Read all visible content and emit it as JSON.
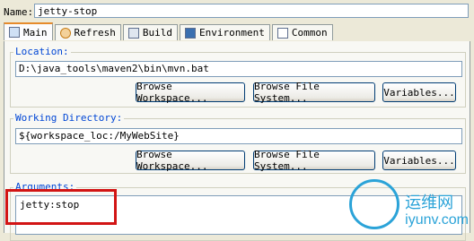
{
  "name": {
    "label": "Name:",
    "value": "jetty-stop"
  },
  "tabs": [
    {
      "label": "Main",
      "icon": "main-icon",
      "active": true
    },
    {
      "label": "Refresh",
      "icon": "refresh-icon"
    },
    {
      "label": "Build",
      "icon": "build-icon"
    },
    {
      "label": "Environment",
      "icon": "environment-icon"
    },
    {
      "label": "Common",
      "icon": "common-icon"
    }
  ],
  "location": {
    "title": "Location:",
    "value": "D:\\java_tools\\maven2\\bin\\mvn.bat",
    "buttons": [
      "Browse Workspace...",
      "Browse File System...",
      "Variables..."
    ]
  },
  "working_directory": {
    "title": "Working Directory:",
    "value": "${workspace_loc:/MyWebSite}",
    "buttons": [
      "Browse Workspace...",
      "Browse File System...",
      "Variables..."
    ]
  },
  "arguments": {
    "title": "Arguments:",
    "value": "jetty:stop"
  },
  "watermark": {
    "cn": "运维网",
    "url": "iyunv.com"
  },
  "colors": {
    "highlight": "#d21414",
    "accent": "#0046d5",
    "watermark": "#2ba3d8"
  }
}
